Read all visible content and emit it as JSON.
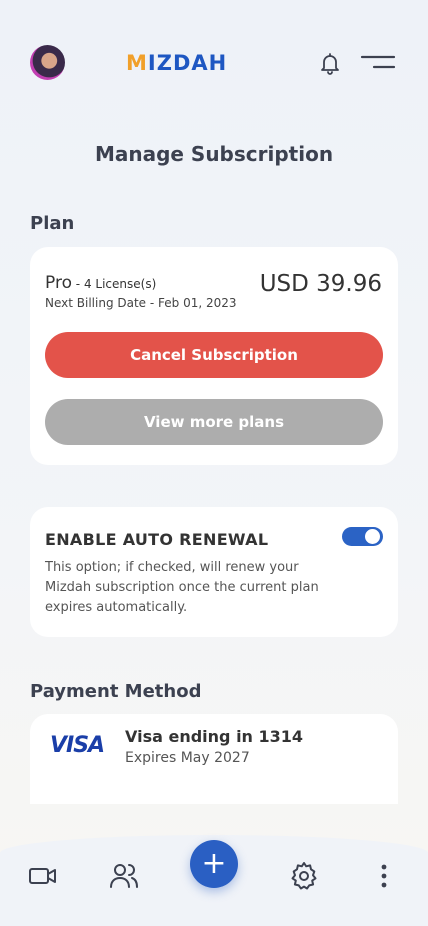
{
  "header": {
    "logo_prefix": "M",
    "logo_rest": "IZDAH",
    "icons": [
      "avatar",
      "bell-icon",
      "menu-icon"
    ]
  },
  "page_title": "Manage Subscription",
  "plan": {
    "section_label": "Plan",
    "name": "Pro",
    "licenses": " - 4 License(s)",
    "billing": "Next Billing Date - Feb 01, 2023",
    "price": "USD 39.96",
    "cancel_label": "Cancel Subscription",
    "more_label": "View more plans"
  },
  "auto_renewal": {
    "title": "ENABLE AUTO RENEWAL",
    "description": "This option; if checked, will renew your Mizdah subscription once the current plan expires automatically.",
    "enabled": true
  },
  "payment": {
    "section_label": "Payment Method",
    "brand": "VISA",
    "title": "Visa ending in 1314",
    "expires": "Expires May 2027"
  },
  "tabbar": {
    "items": [
      "video-icon",
      "users-icon",
      "add-icon",
      "gear-icon",
      "more-icon"
    ],
    "add_label": "+"
  },
  "colors": {
    "primary": "#2a5fc3",
    "danger": "#e3534a",
    "disabled": "#adadad",
    "logo_accent": "#f1a02a"
  }
}
